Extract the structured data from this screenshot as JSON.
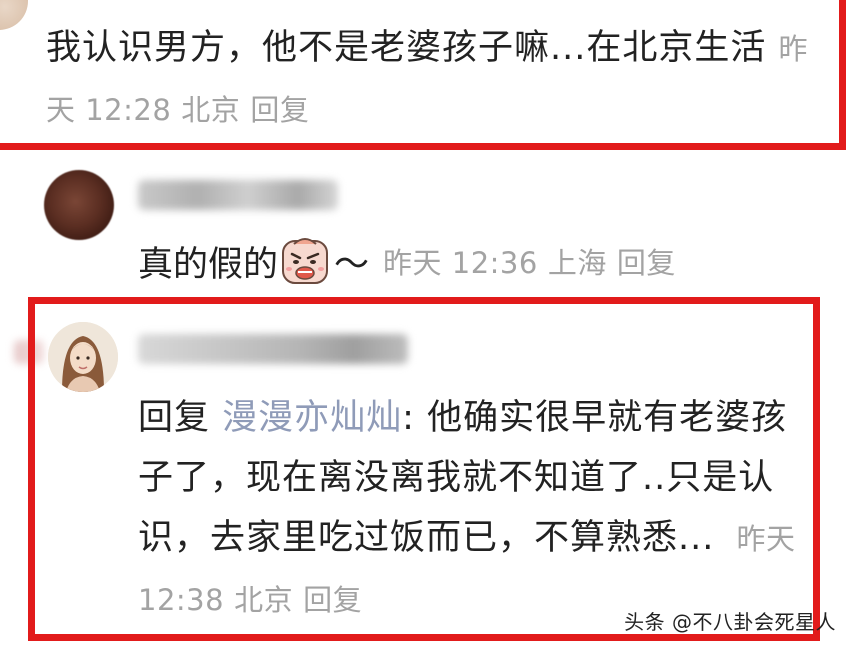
{
  "comment1": {
    "text": "我认识男方，他不是老婆孩子嘛...在北京生活",
    "time": "昨天 12:28",
    "location": "北京",
    "reply_label": "回复"
  },
  "comment2": {
    "text": "真的假的",
    "emoji": "smirk-face-emoji",
    "tilde": "～",
    "time": "昨天 12:36",
    "location": "上海",
    "reply_label": "回复"
  },
  "comment3": {
    "reply_prefix": "回复",
    "reply_to": "漫漫亦灿灿",
    "text": ": 他确实很早就有老婆孩子了，现在离没离我就不知道了..只是认识，去家里吃过饭而已，不算熟悉...",
    "time": "昨天 12:38",
    "location": "北京",
    "reply_label": "回复"
  },
  "watermark": "头条 @不八卦会死星人",
  "colors": {
    "highlight_border": "#e21b1b",
    "meta_text": "#a3a3a3",
    "reply_name": "#8f9bb8",
    "body_text": "#222222"
  }
}
